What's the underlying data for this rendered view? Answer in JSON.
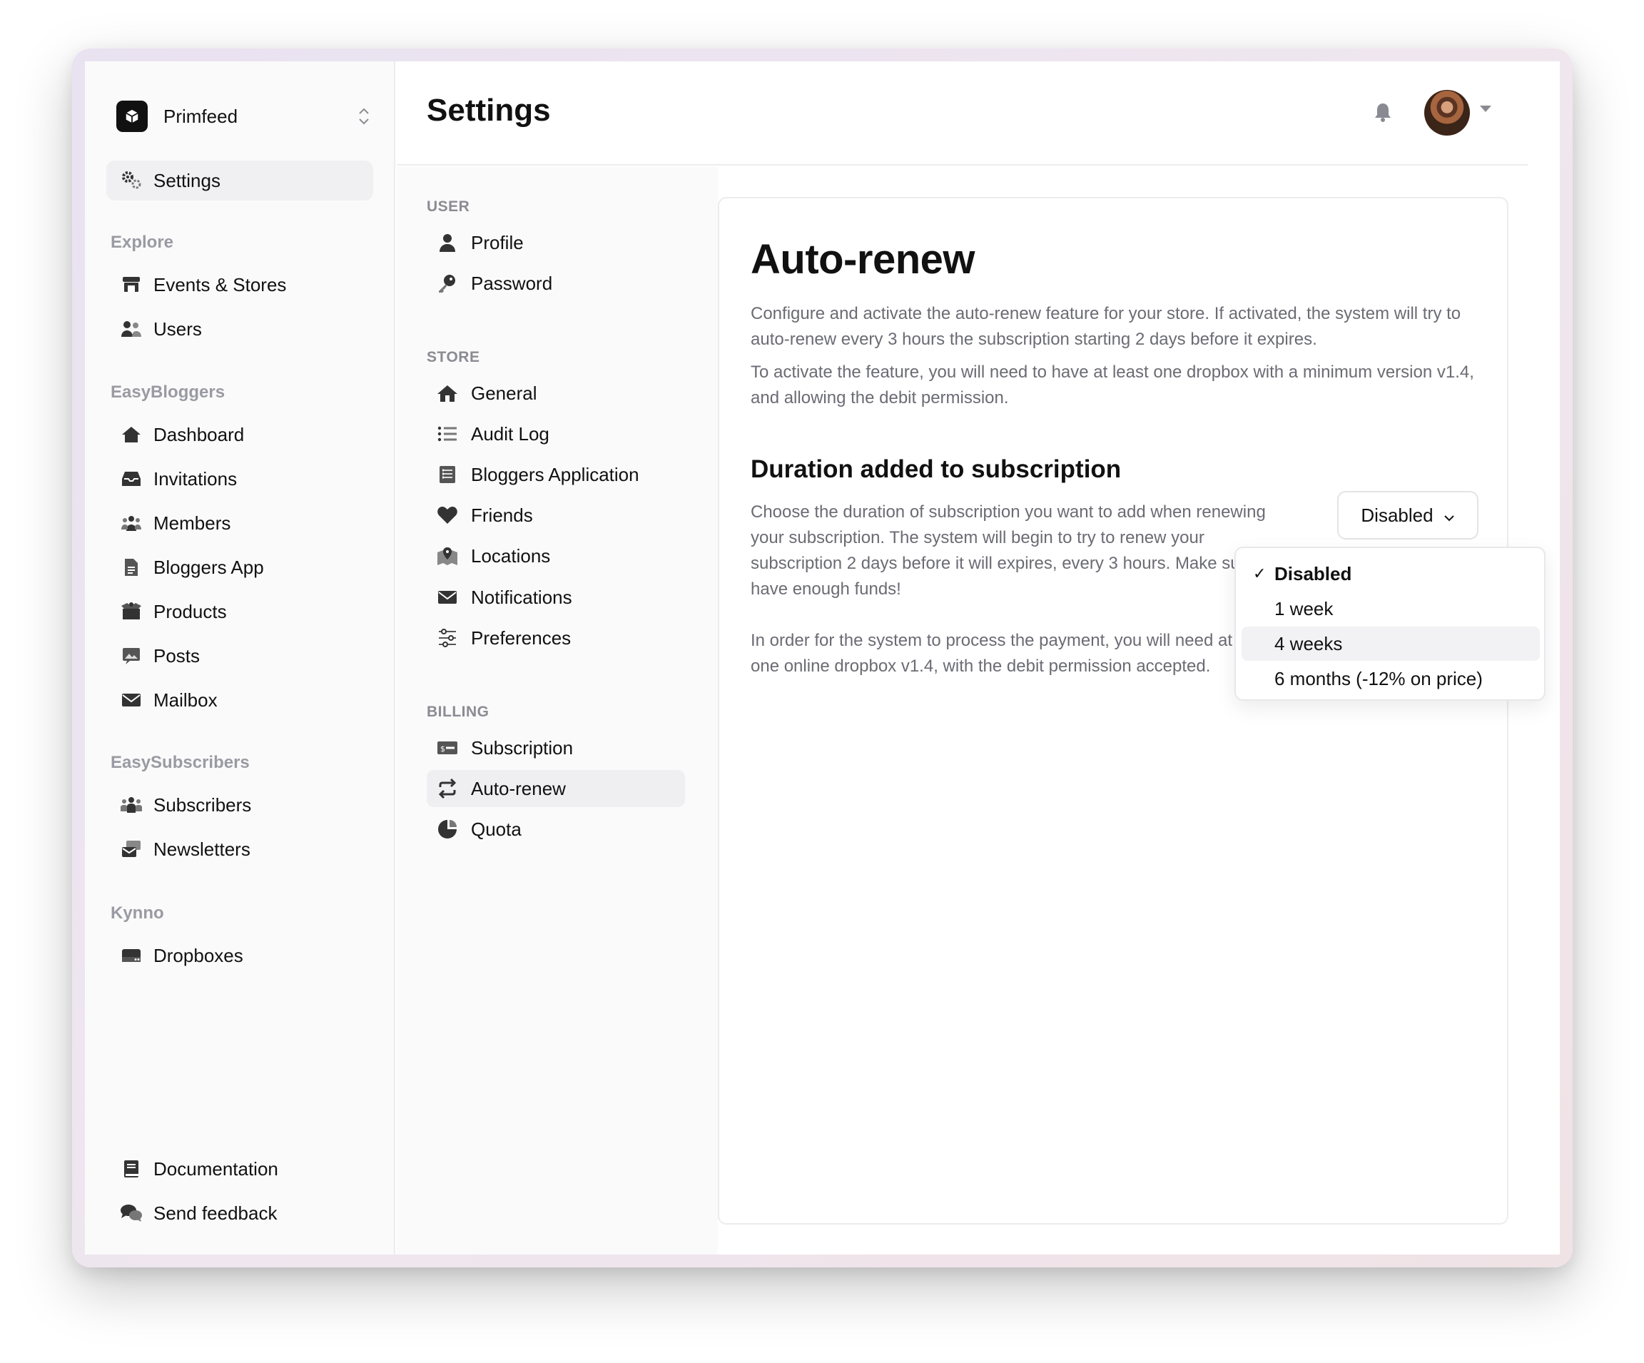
{
  "brand": {
    "name": "Primfeed"
  },
  "sidebar": {
    "top_item": {
      "label": "Settings",
      "icon": "gears-icon"
    },
    "sections": [
      {
        "heading": "Explore",
        "items": [
          {
            "label": "Events & Stores",
            "icon": "store-icon"
          },
          {
            "label": "Users",
            "icon": "users-icon"
          }
        ]
      },
      {
        "heading": "EasyBloggers",
        "items": [
          {
            "label": "Dashboard",
            "icon": "home-icon"
          },
          {
            "label": "Invitations",
            "icon": "inbox-icon"
          },
          {
            "label": "Members",
            "icon": "group-icon"
          },
          {
            "label": "Bloggers App",
            "icon": "file-icon"
          },
          {
            "label": "Products",
            "icon": "box-icon"
          },
          {
            "label": "Posts",
            "icon": "image-icon"
          },
          {
            "label": "Mailbox",
            "icon": "envelope-icon"
          }
        ]
      },
      {
        "heading": "EasySubscribers",
        "items": [
          {
            "label": "Subscribers",
            "icon": "people-icon"
          },
          {
            "label": "Newsletters",
            "icon": "mail-stack-icon"
          }
        ]
      },
      {
        "heading": "Kynno",
        "items": [
          {
            "label": "Dropboxes",
            "icon": "drive-icon"
          }
        ]
      }
    ],
    "bottom_items": [
      {
        "label": "Documentation",
        "icon": "book-icon"
      },
      {
        "label": "Send feedback",
        "icon": "chat-icon"
      }
    ]
  },
  "header": {
    "title": "Settings"
  },
  "settings_nav": {
    "groups": [
      {
        "heading": "USER",
        "items": [
          {
            "label": "Profile",
            "icon": "person-icon"
          },
          {
            "label": "Password",
            "icon": "key-icon"
          }
        ]
      },
      {
        "heading": "STORE",
        "items": [
          {
            "label": "General",
            "icon": "home-icon"
          },
          {
            "label": "Audit Log",
            "icon": "list-icon"
          },
          {
            "label": "Bloggers Application",
            "icon": "document-list-icon"
          },
          {
            "label": "Friends",
            "icon": "heart-icon"
          },
          {
            "label": "Locations",
            "icon": "map-pin-icon"
          },
          {
            "label": "Notifications",
            "icon": "envelope-icon"
          },
          {
            "label": "Preferences",
            "icon": "sliders-icon"
          }
        ]
      },
      {
        "heading": "BILLING",
        "items": [
          {
            "label": "Subscription",
            "icon": "money-icon"
          },
          {
            "label": "Auto-renew",
            "icon": "repeat-icon",
            "active": true
          },
          {
            "label": "Quota",
            "icon": "pie-icon"
          }
        ]
      }
    ]
  },
  "content": {
    "title": "Auto-renew",
    "intro_1": "Configure and activate the auto-renew feature for your store. If activated, the system will try to auto-renew every 3 hours the subscription starting 2 days before it expires.",
    "intro_2": "To activate the feature, you will need to have at least one dropbox with a minimum version v1.4, and allowing the debit permission.",
    "section_title": "Duration added to subscription",
    "section_text_1": "Choose the duration of subscription you want to add when renewing your subscription. The system will begin to try to renew your subscription 2 days before it will expires, every 3 hours. Make sure to have enough funds!",
    "section_text_2": "In order for the system to process the payment, you will need at least one online dropbox v1.4, with the debit permission accepted.",
    "select_value": "Disabled",
    "options": [
      "Disabled",
      "1 week",
      "4 weeks",
      "6 months (-12% on price)"
    ],
    "selected_index": 0,
    "hovered_index": 2
  }
}
